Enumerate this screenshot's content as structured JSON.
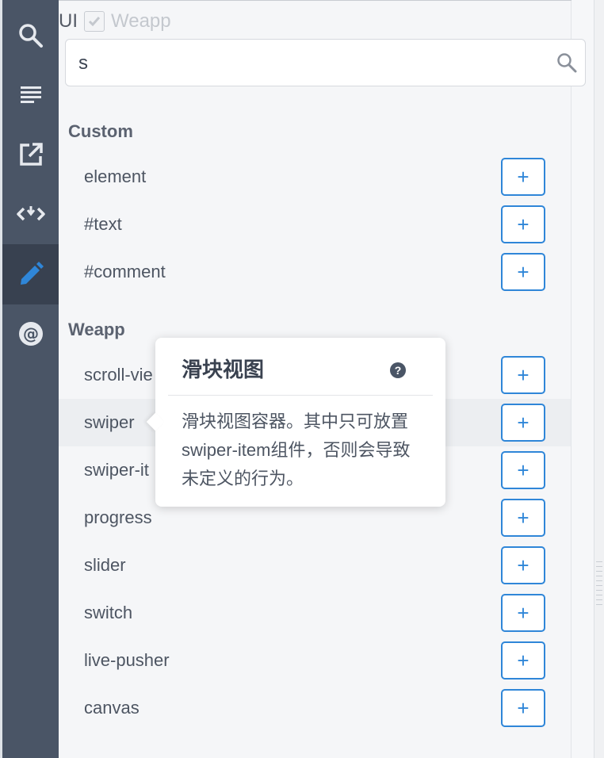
{
  "sidebar": {
    "items": [
      {
        "icon": "search-icon"
      },
      {
        "icon": "list-icon"
      },
      {
        "icon": "external-link-icon"
      },
      {
        "icon": "code-arrows-icon"
      },
      {
        "icon": "pencil-icon",
        "active": true
      },
      {
        "icon": "at-icon"
      }
    ]
  },
  "filter": {
    "ui_label": "UI",
    "weapp_label": "Weapp",
    "weapp_checked": true
  },
  "search": {
    "value": "s",
    "placeholder": ""
  },
  "groups": {
    "custom": {
      "title": "Custom",
      "items": [
        "element",
        "#text",
        "#comment"
      ]
    },
    "weapp": {
      "title": "Weapp",
      "items": [
        "scroll-vie",
        "swiper",
        "swiper-it",
        "progress",
        "slider",
        "switch",
        "live-pusher",
        "canvas"
      ]
    }
  },
  "add_label": "+",
  "tooltip": {
    "title": "滑块视图",
    "help": "?",
    "body": "滑块视图容器。其中只可放置swiper-item组件，否则会导致未定义的行为。"
  },
  "colors": {
    "sidebar_bg": "#4a5566",
    "sidebar_active_bg": "#384150",
    "active_icon": "#2f86d8",
    "add_button_border": "#2f86d8"
  }
}
